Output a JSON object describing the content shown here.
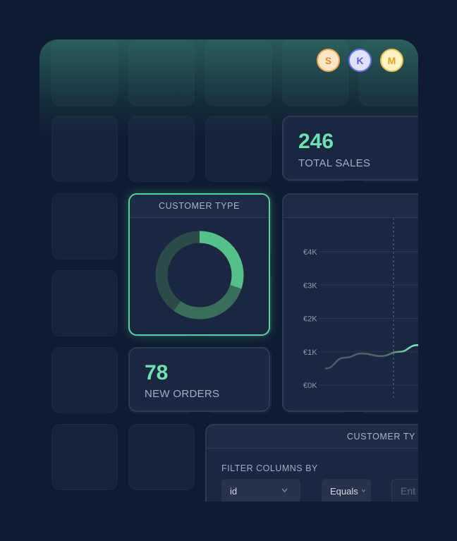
{
  "avatars": [
    {
      "initial": "S",
      "bg": "#fce6c8",
      "border": "#f0a54b",
      "color": "#e08a2a"
    },
    {
      "initial": "K",
      "bg": "#dfe2fb",
      "border": "#6e74e8",
      "color": "#5a5fd6"
    },
    {
      "initial": "M",
      "bg": "#fdf3c6",
      "border": "#e9c24a",
      "color": "#d8a91d"
    }
  ],
  "total_sales": {
    "value": "246",
    "label": "TOTAL SALES"
  },
  "new_orders": {
    "value": "78",
    "label": "NEW ORDERS"
  },
  "customer_type_card": {
    "title": "CUSTOMER TYPE"
  },
  "table_card": {
    "title": "CUSTOMER TY",
    "filter_label": "FILTER COLUMNS BY",
    "column_select": {
      "value": "id"
    },
    "operator_select": {
      "value": "Equals"
    },
    "value_input": {
      "placeholder": "Ent"
    }
  },
  "colors": {
    "accent": "#5ccf9f",
    "donut_primary": "#54c08a",
    "donut_secondary": "#3a6e5c",
    "donut_track": "#2c4a47"
  },
  "chart_data": [
    {
      "type": "pie",
      "title": "CUSTOMER TYPE",
      "values": [
        30,
        30,
        40
      ],
      "colors": [
        "#54c08a",
        "#3a6e5c",
        "#2c4a47"
      ]
    },
    {
      "type": "line",
      "y_ticks": [
        "€0K",
        "€1K",
        "€2K",
        "€3K",
        "€4K"
      ],
      "ylim": [
        0,
        4000
      ],
      "grid": true,
      "series": [
        {
          "x": [
            0,
            1,
            2,
            3,
            4,
            5,
            6
          ],
          "y": [
            500,
            820,
            950,
            870,
            1000,
            1200,
            1130
          ]
        }
      ]
    }
  ]
}
